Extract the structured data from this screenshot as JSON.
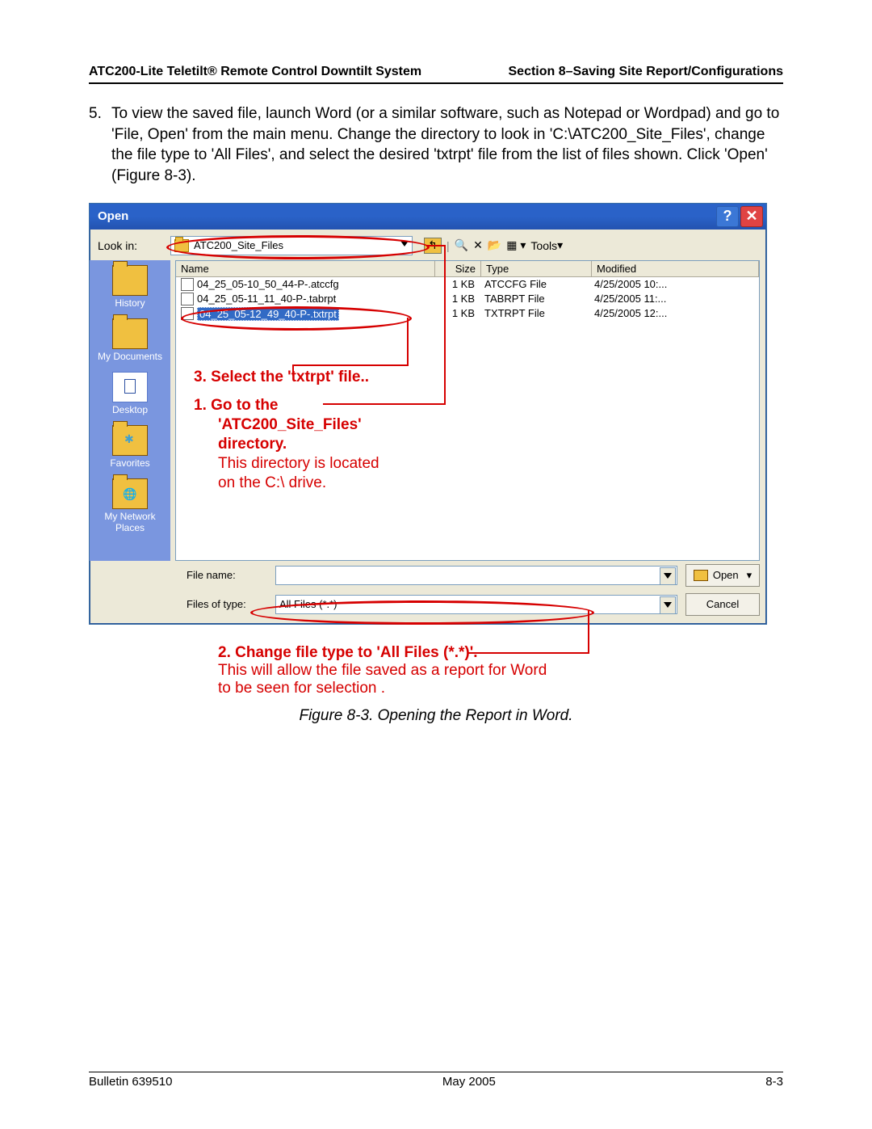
{
  "header": {
    "left": "ATC200-Lite Teletilt® Remote Control Downtilt System",
    "right": "Section 8–Saving Site Report/Configurations"
  },
  "step": {
    "number": "5.",
    "text": "To view the saved file, launch Word (or a similar software, such as Notepad or Wordpad) and go to 'File, Open' from the main menu. Change the directory to look in 'C:\\ATC200_Site_Files', change the file type to 'All Files', and select the desired 'txtrpt' file from the list of files shown. Click 'Open' (Figure 8-3)."
  },
  "dialog": {
    "title": "Open",
    "lookin_label": "Look in:",
    "lookin_value": "ATC200_Site_Files",
    "tools_label": "Tools",
    "sidebar": [
      {
        "label": "History"
      },
      {
        "label": "My Documents"
      },
      {
        "label": "Desktop"
      },
      {
        "label": "Favorites"
      },
      {
        "label": "My Network Places"
      }
    ],
    "columns": {
      "name": "Name",
      "size": "Size",
      "type": "Type",
      "modified": "Modified"
    },
    "files": [
      {
        "name": "04_25_05-10_50_44-P-.atccfg",
        "size": "1 KB",
        "type": "ATCCFG File",
        "modified": "4/25/2005 10:..."
      },
      {
        "name": "04_25_05-11_11_40-P-.tabrpt",
        "size": "1 KB",
        "type": "TABRPT File",
        "modified": "4/25/2005 11:..."
      },
      {
        "name": "04_25_05-12_49_40-P-.txtrpt",
        "size": "1 KB",
        "type": "TXTRPT File",
        "modified": "4/25/2005 12:..."
      }
    ],
    "filename_label": "File name:",
    "filetype_label": "Files of type:",
    "filetype_value": "All Files (*.*)",
    "open_btn": "Open",
    "cancel_btn": "Cancel"
  },
  "annotations": {
    "a3": "3.  Select the 'txtrpt' file..",
    "a1_l1": "1.  Go to the",
    "a1_l2": "'ATC200_Site_Files'",
    "a1_l3": "directory.",
    "a1_sub1": "This directory is located",
    "a1_sub2": "on the C:\\ drive.",
    "a2_l1": "2.  Change file type to 'All Files (*.*)'.",
    "a2_sub1": "This will allow the file saved as a report for Word",
    "a2_sub2": "to be seen for selection ."
  },
  "caption": "Figure 8-3. Opening the Report in Word.",
  "footer": {
    "left": "Bulletin 639510",
    "center": "May 2005",
    "right": "8-3"
  }
}
